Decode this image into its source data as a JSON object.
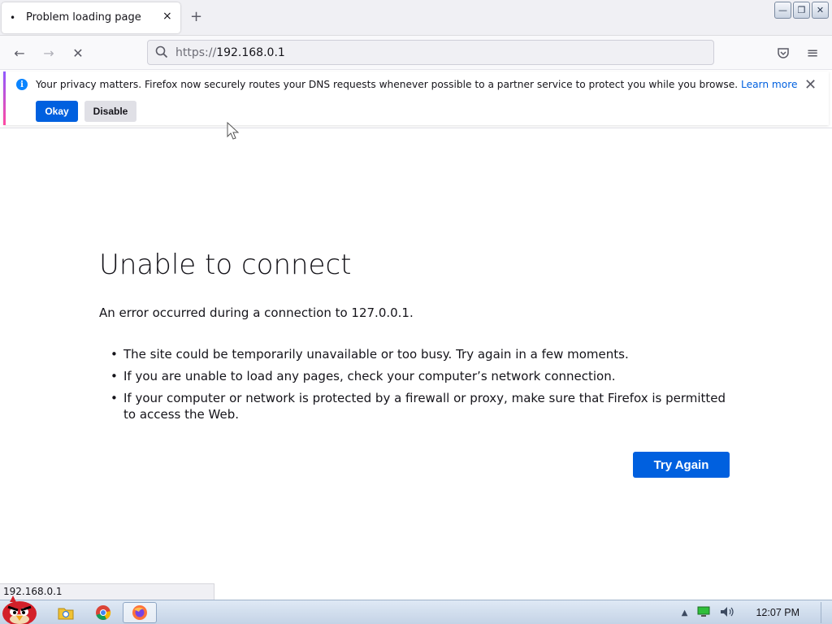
{
  "browser": {
    "tab": {
      "title": "Problem loading page",
      "loading_indicator": "•",
      "close_glyph": "×"
    },
    "new_tab_glyph": "+",
    "window_controls": {
      "minimize": "—",
      "restore": "❐",
      "close": "✕"
    },
    "nav": {
      "back_glyph": "←",
      "forward_glyph": "→",
      "stop_glyph": "✕",
      "url_scheme": "https://",
      "url_host": "192.168.0.1",
      "pocket_icon": "pocket-icon",
      "menu_glyph": "≡"
    }
  },
  "notification": {
    "info_glyph": "i",
    "message": "Your privacy matters. Firefox now securely routes your DNS requests whenever possible to a partner service to protect you while you browse.",
    "learn_more": "Learn more",
    "okay": "Okay",
    "disable": "Disable",
    "close_glyph": "✕"
  },
  "error": {
    "title": "Unable to connect",
    "description": "An error occurred during a connection to 127.0.0.1.",
    "bullets": [
      "The site could be temporarily unavailable or too busy. Try again in a few moments.",
      "If you are unable to load any pages, check your computer’s network connection.",
      "If your computer or network is protected by a firewall or proxy, make sure that Firefox is permitted to access the Web."
    ],
    "try_again": "Try Again"
  },
  "status_text": "192.168.0.1",
  "taskbar": {
    "apps": [
      "start-bird-icon",
      "file-explorer-icon",
      "chrome-icon",
      "firefox-icon"
    ],
    "clock": "12:07 PM"
  },
  "colors": {
    "accent_blue": "#0060df",
    "info_blue": "#0a84ff"
  }
}
